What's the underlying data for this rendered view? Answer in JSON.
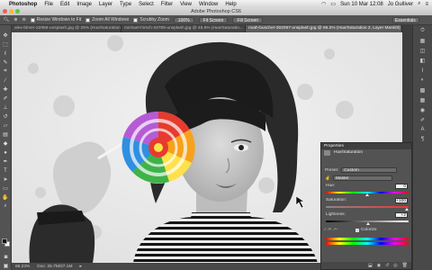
{
  "menubar": {
    "app_name": "Photoshop",
    "items": [
      "File",
      "Edit",
      "Image",
      "Layer",
      "Type",
      "Select",
      "Filter",
      "View",
      "Window",
      "Help"
    ],
    "clock": "Sun 10 Mar  12:08",
    "user": "Jo Gulliver"
  },
  "window": {
    "title": "Adobe Photoshop CS6"
  },
  "options": {
    "resize_label": "Resize Windows to Fit",
    "zoom_all_label": "Zoom All Windows",
    "scrubby_label": "Scrubby Zoom",
    "pct_label": "100%",
    "fit_label": "Fit Screen",
    "fill_label": "Fill Screen",
    "workspace": "Essentials"
  },
  "tabs": [
    {
      "label": "alex-blmer-22959-unsplash.jpg @ 25% (Hue/Saturation 1, ..."
    },
    {
      "label": "michael-hirsch-34785-unsplash.jpg @ 45.6% (Hue/Saturatio..."
    },
    {
      "label": "noah-buscher-302067-unsplash.jpg @ 66.2% (Hue/Saturation 2, Layer Mask/8) *"
    }
  ],
  "status": {
    "zoom": "66.23%",
    "doc": "Doc: 25.7M/27.1M"
  },
  "properties": {
    "title": "Properties",
    "subtitle": "Hue/Saturation",
    "preset_label": "Preset:",
    "preset_value": "Custom",
    "channel_value": "Master",
    "hue_label": "Hue:",
    "hue_value": "0",
    "saturation_label": "Saturation:",
    "saturation_value": "+100",
    "lightness_label": "Lightness:",
    "lightness_value": "+2",
    "colorize_label": "Colorize"
  },
  "colors": {
    "lollipop": [
      "#e63b2e",
      "#f7a21b",
      "#ffe14a",
      "#3fb24a",
      "#2f8fe0",
      "#b65bd6"
    ]
  }
}
